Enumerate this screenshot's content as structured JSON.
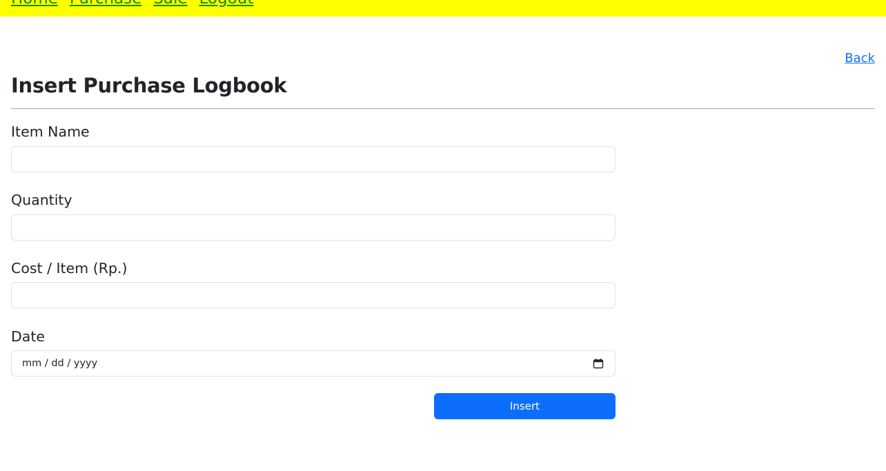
{
  "nav": {
    "items": [
      {
        "label": "Home"
      },
      {
        "label": "Purchase"
      },
      {
        "label": "Sale"
      },
      {
        "label": "Logout"
      }
    ],
    "background": "#ffff00",
    "link_color": "#0a8a0a"
  },
  "back_link": {
    "label": "Back"
  },
  "page_title": "Insert Purchase Logbook",
  "form": {
    "item_name": {
      "label": "Item Name",
      "value": "",
      "placeholder": ""
    },
    "quantity": {
      "label": "Quantity",
      "value": "",
      "placeholder": ""
    },
    "cost": {
      "label": "Cost / Item (Rp.)",
      "value": "",
      "placeholder": ""
    },
    "date": {
      "label": "Date",
      "display": "mm / dd / yyyy",
      "icon": "calendar-icon"
    },
    "submit_label": "Insert"
  },
  "colors": {
    "primary": "#0d6efd",
    "text": "#212529",
    "input_border": "#dee2e6"
  }
}
